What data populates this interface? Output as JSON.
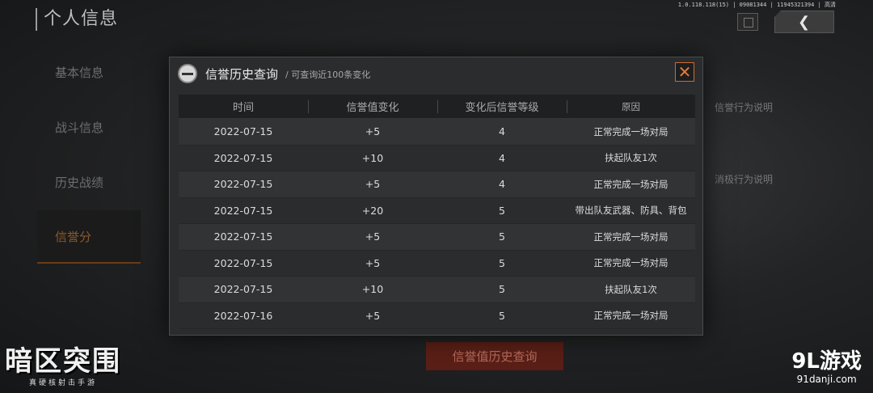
{
  "page": {
    "title": "个人信息",
    "version": "1.0.118.118(15) | 09081344 | 11945321394 | 高清"
  },
  "side_nav": [
    {
      "label": "基本信息",
      "active": false
    },
    {
      "label": "战斗信息",
      "active": false
    },
    {
      "label": "历史战绩",
      "active": false
    },
    {
      "label": "信誉分",
      "active": true
    }
  ],
  "right_info": {
    "positive_heading": "信誉行为说明",
    "negative_heading": "消极行为说明"
  },
  "bottom_button": "信誉值历史查询",
  "logo": {
    "name": "暗区突围",
    "tagline": "真硬核射击手游"
  },
  "watermark": {
    "main": "9L游戏",
    "sub": "91danji.com"
  },
  "dialog": {
    "title": "信誉历史查询",
    "subtitle": "/ 可查询近100条变化",
    "close_icon": "close-icon",
    "columns": [
      "时间",
      "信誉值变化",
      "变化后信誉等级",
      "原因"
    ],
    "rows": [
      {
        "time": "2022-07-15",
        "change": "+5",
        "level": "4",
        "reason": "正常完成一场对局"
      },
      {
        "time": "2022-07-15",
        "change": "+10",
        "level": "4",
        "reason": "扶起队友1次"
      },
      {
        "time": "2022-07-15",
        "change": "+5",
        "level": "4",
        "reason": "正常完成一场对局"
      },
      {
        "time": "2022-07-15",
        "change": "+20",
        "level": "5",
        "reason": "带出队友武器、防具、背包"
      },
      {
        "time": "2022-07-15",
        "change": "+5",
        "level": "5",
        "reason": "正常完成一场对局"
      },
      {
        "time": "2022-07-15",
        "change": "+5",
        "level": "5",
        "reason": "正常完成一场对局"
      },
      {
        "time": "2022-07-15",
        "change": "+10",
        "level": "5",
        "reason": "扶起队友1次"
      },
      {
        "time": "2022-07-16",
        "change": "+5",
        "level": "5",
        "reason": "正常完成一场对局"
      }
    ]
  },
  "colors": {
    "accent": "#e37a39",
    "active_nav": "#8c5a2b",
    "bottom_button_bg": "#5a1f16"
  }
}
